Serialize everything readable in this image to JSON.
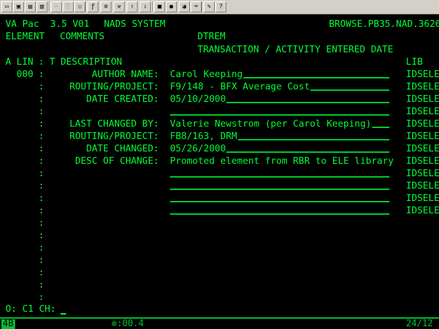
{
  "toolbar": {
    "icons": [
      "new-icon",
      "open-icon",
      "save-icon",
      "print-icon",
      "cut-icon",
      "copy-icon",
      "paste-icon",
      "macro-icon",
      "format-icon",
      "tools-icon",
      "send-icon",
      "receive-icon",
      "stop-icon",
      "color-icon",
      "palette-icon",
      "keyboard-icon",
      "edit-icon",
      "help-icon"
    ],
    "glyphs": [
      "▭",
      "▣",
      "▤",
      "▥",
      "✂",
      "⎘",
      "▦",
      "ƒ",
      "≡",
      "⚒",
      "⇧",
      "⇩",
      "■",
      "●",
      "◕",
      "⌨",
      "✎",
      "?"
    ]
  },
  "header": {
    "product": "VA Pac  3.5 V01",
    "system": "NADS SYSTEM",
    "screen_id": "BROWSE.PB35.NAD.3626",
    "element_label": "ELEMENT",
    "comments_label": "COMMENTS",
    "element_code": "DTREM",
    "element_desc": "TRANSACTION / ACTIVITY ENTERED DATE"
  },
  "columns": {
    "a": "A",
    "lin": "LIN",
    "sep": ":",
    "t": "T",
    "description": "DESCRIPTION",
    "lib": "LIB"
  },
  "lines": [
    {
      "num": "000",
      "label": "AUTHOR NAME:",
      "value": "Carol Keeping",
      "lib": "IDSELE"
    },
    {
      "num": "",
      "label": "ROUTING/PROJECT:",
      "value": "F9/148 - BFX Average Cost",
      "lib": "IDSELE"
    },
    {
      "num": "",
      "label": "DATE CREATED:",
      "value": "05/10/2000",
      "lib": "IDSELE"
    },
    {
      "num": "",
      "label": "",
      "value": "",
      "lib": "IDSELE"
    },
    {
      "num": "",
      "label": "LAST CHANGED BY:",
      "value": "Valerie Newstrom (per Carol Keeping)",
      "lib": "IDSELE"
    },
    {
      "num": "",
      "label": "ROUTING/PROJECT:",
      "value": "FB8/163, DRM",
      "lib": "IDSELE"
    },
    {
      "num": "",
      "label": "DATE CHANGED:",
      "value": "05/26/2000",
      "lib": "IDSELE"
    },
    {
      "num": "",
      "label": "DESC OF CHANGE:",
      "value": "Promoted element from RBR to ELE library",
      "lib": "IDSELE"
    },
    {
      "num": "",
      "label": "",
      "value": "",
      "lib": "IDSELE"
    },
    {
      "num": "",
      "label": "",
      "value": "",
      "lib": "IDSELE"
    },
    {
      "num": "",
      "label": "",
      "value": "",
      "lib": "IDSELE"
    },
    {
      "num": "",
      "label": "",
      "value": "",
      "lib": "IDSELE"
    }
  ],
  "command": {
    "label": "O: C1 CH:",
    "value": ""
  },
  "status": {
    "session": "4B",
    "timer": "⊕:00.4",
    "position": "24/12"
  }
}
